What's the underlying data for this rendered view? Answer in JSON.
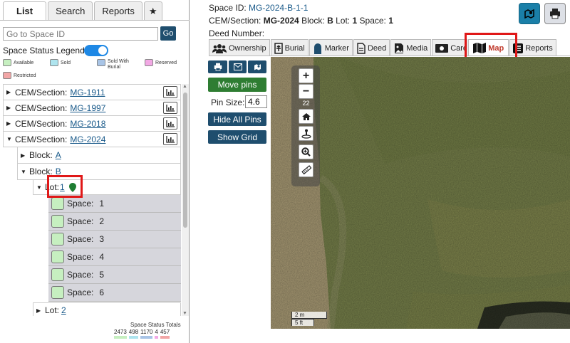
{
  "left_tabs": [
    "List",
    "Search",
    "Reports",
    "★"
  ],
  "search": {
    "placeholder": "Go to Space ID",
    "go_label": "Go"
  },
  "legend": {
    "title": "Space Status Legend:",
    "items": [
      {
        "label": "Available",
        "color": "#c6efc0"
      },
      {
        "label": "Sold",
        "color": "#aee4ee"
      },
      {
        "label": "Sold With Burial",
        "color": "#a8c4e6"
      },
      {
        "label": "Reserved",
        "color": "#f2a8e4"
      },
      {
        "label": "Restricted",
        "color": "#f2a6a6"
      }
    ]
  },
  "tree": {
    "sections": [
      {
        "label": "CEM/Section:",
        "id": "MG-1911"
      },
      {
        "label": "CEM/Section:",
        "id": "MG-1997"
      },
      {
        "label": "CEM/Section:",
        "id": "MG-2018"
      },
      {
        "label": "CEM/Section:",
        "id": "MG-2024"
      }
    ],
    "blocks": [
      {
        "label": "Block:",
        "id": "A"
      },
      {
        "label": "Block:",
        "id": "B"
      }
    ],
    "lots": [
      {
        "label": "Lot:",
        "id": "1"
      },
      {
        "label": "Lot:",
        "id": "2"
      }
    ],
    "spaces": [
      {
        "label": "Space:",
        "num": "1"
      },
      {
        "label": "Space:",
        "num": "2"
      },
      {
        "label": "Space:",
        "num": "3"
      },
      {
        "label": "Space:",
        "num": "4"
      },
      {
        "label": "Space:",
        "num": "5"
      },
      {
        "label": "Space:",
        "num": "6"
      }
    ]
  },
  "totals": {
    "title": "Space Status Totals",
    "values": [
      "2473",
      "498",
      "1170",
      "4",
      "457"
    ]
  },
  "header": {
    "space_id_label": "Space ID:",
    "space_id": "MG-2024-B-1-1",
    "section_label": "CEM/Section:",
    "section": "MG-2024",
    "block_label": "Block:",
    "block": "B",
    "lot_label": "Lot:",
    "lot": "1",
    "space_label": "Space:",
    "space": "1",
    "deed_label": "Deed Number:"
  },
  "detail_tabs": [
    {
      "label": "Ownership",
      "icon": "users-icon"
    },
    {
      "label": "Burial",
      "icon": "burial-icon"
    },
    {
      "label": "Marker",
      "icon": "headstone-icon"
    },
    {
      "label": "Deed",
      "icon": "document-icon"
    },
    {
      "label": "Media",
      "icon": "image-icon"
    },
    {
      "label": "Care",
      "icon": "money-icon"
    },
    {
      "label": "Map",
      "icon": "map-icon"
    },
    {
      "label": "Reports",
      "icon": "list-icon"
    }
  ],
  "map_tools": {
    "move_pins": "Move pins",
    "pin_size_label": "Pin Size:",
    "pin_size": "4.6",
    "hide_pins": "Hide All Pins",
    "show_grid": "Show Grid"
  },
  "map": {
    "zoom_level": "22",
    "scale_metric": "2 m",
    "scale_imperial": "5 ft"
  },
  "colors": {
    "accent": "#1f4e6e",
    "active_tab": "#c0392b",
    "green": "#2e7d32",
    "highlight": "#e01818"
  }
}
